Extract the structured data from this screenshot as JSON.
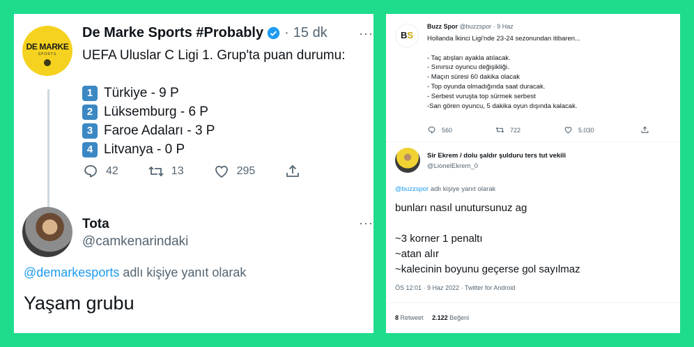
{
  "left": {
    "tweet": {
      "avatar_text": "DE MARKE",
      "avatar_sub": "SPORTS",
      "name": "De Marke Sports #Probably",
      "separator": "·",
      "time": "15 dk",
      "more": "···",
      "text": "UEFA Uluslar C Ligi 1. Grup'ta puan durumu:",
      "rankings": [
        {
          "num": "1",
          "text": "Türkiye - 9 P"
        },
        {
          "num": "2",
          "text": "Lüksemburg - 6 P"
        },
        {
          "num": "3",
          "text": "Faroe Adaları - 3 P"
        },
        {
          "num": "4",
          "text": "Litvanya - 0 P"
        }
      ],
      "replies": "42",
      "retweets": "13",
      "likes": "295"
    },
    "reply": {
      "name": "Tota",
      "handle": "@camkenarindaki",
      "more": "···",
      "reply_mention": "@demarkesports",
      "reply_suffix": " adlı kişiye yanıt olarak",
      "text": "Yaşam grubu"
    }
  },
  "right": {
    "tweet": {
      "avatar_text_a": "B",
      "avatar_text_b": "S",
      "name": "Buzz Spor",
      "meta": " @buzzspor · 9 Haz",
      "text": "Hollanda İkinci Ligi'nde 23-24 sezonundan itibaren...\n\n- Taç atışları ayakla atılacak.\n- Sınırsız oyuncu değişikliği.\n- Maçın süresi 60 dakika olacak\n- Top oyunda olmadığında saat duracak.\n- Serbest vuruşta top sürmek serbest\n-San gören oyuncu, 5 dakika oyun dışında kalacak.",
      "replies": "560",
      "retweets": "722",
      "likes": "5.030"
    },
    "reply": {
      "name": "Sir Ekrem / dolu şaldır şulduru ters tut vekili",
      "handle": "@LionelEkrem_0",
      "reply_mention": "@buzzspor",
      "reply_suffix": " adlı kişiye yanıt olarak",
      "text": "bunları nasıl unutursunuz ag\n\n~3 korner 1 penaltı\n~atan alır\n~kalecinin boyunu geçerse gol sayılmaz",
      "footer": "ÖS 12:01 · 9 Haz 2022 · Twitter for Android",
      "retweet_count": "8",
      "retweet_label": " Retweet",
      "like_count": "2.122",
      "like_label": " Beğeni"
    }
  },
  "colors": {
    "background": "#1fdc8c",
    "link": "#1d9bf0",
    "secondary_text": "#536471",
    "keycap": "#3b88c3"
  }
}
